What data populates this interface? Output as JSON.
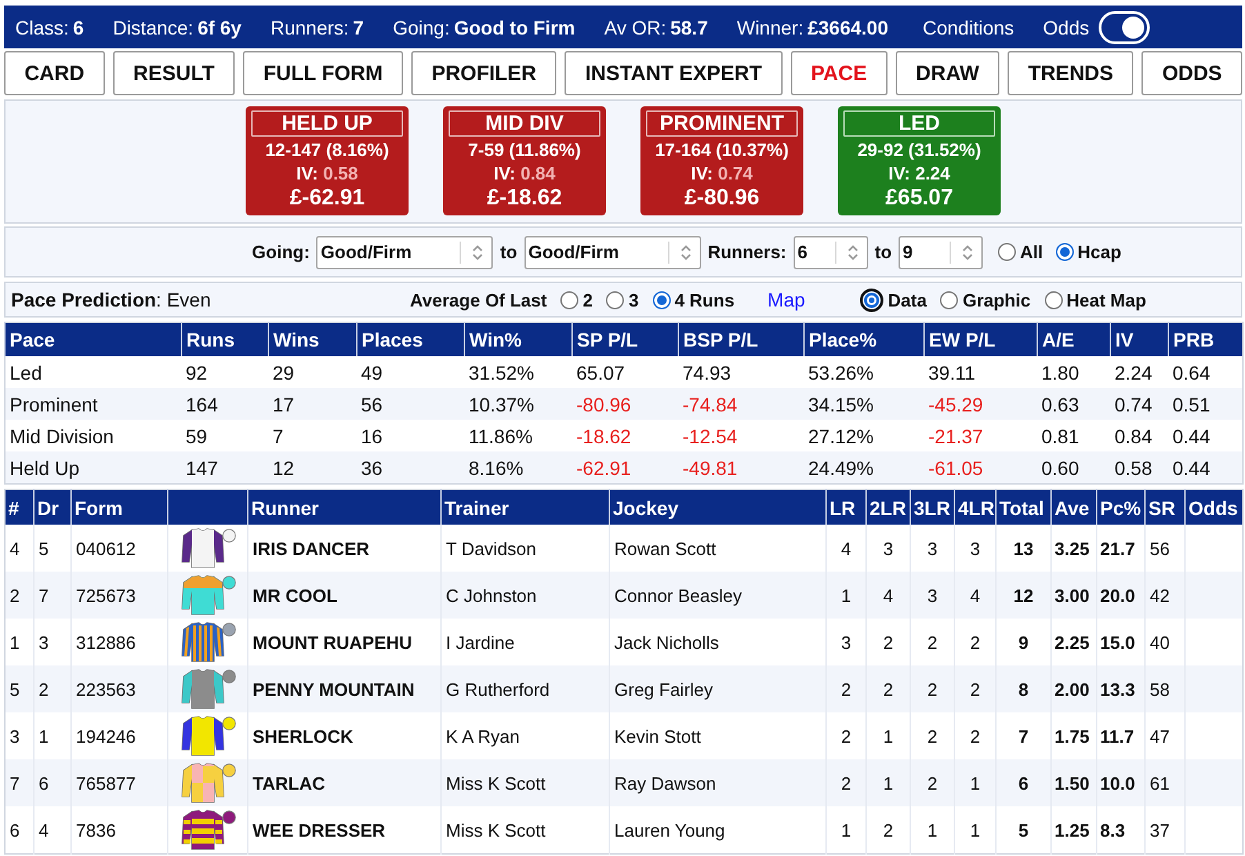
{
  "race_info": {
    "items": [
      {
        "label": "Class:",
        "value": "6"
      },
      {
        "label": "Distance:",
        "value": "6f 6y"
      },
      {
        "label": "Runners:",
        "value": "7"
      },
      {
        "label": "Going:",
        "value": "Good to Firm"
      },
      {
        "label": "Av OR:",
        "value": "58.7"
      },
      {
        "label": "Winner:",
        "value": "£3664.00"
      }
    ],
    "conditions_link": "Conditions",
    "odds_toggle": {
      "label": "Odds",
      "on": true
    }
  },
  "tabs": [
    {
      "label": "CARD",
      "selected": false
    },
    {
      "label": "RESULT",
      "selected": false
    },
    {
      "label": "FULL FORM",
      "selected": false
    },
    {
      "label": "PROFILER",
      "selected": false
    },
    {
      "label": "INSTANT EXPERT",
      "selected": false
    },
    {
      "label": "PACE",
      "selected": true
    },
    {
      "label": "DRAW",
      "selected": false
    },
    {
      "label": "TRENDS",
      "selected": false
    },
    {
      "label": "ODDS",
      "selected": false
    }
  ],
  "pace_summary": [
    {
      "kind": "loss",
      "title": "HELD UP",
      "record": "12-147 (8.16%)",
      "iv_label": "IV:",
      "iv": "0.58",
      "profit": "£-62.91"
    },
    {
      "kind": "loss",
      "title": "MID DIV",
      "record": "7-59 (11.86%)",
      "iv_label": "IV:",
      "iv": "0.84",
      "profit": "£-18.62"
    },
    {
      "kind": "loss",
      "title": "PROMINENT",
      "record": "17-164 (10.37%)",
      "iv_label": "IV:",
      "iv": "0.74",
      "profit": "£-80.96"
    },
    {
      "kind": "profit",
      "title": "LED",
      "record": "29-92 (31.52%)",
      "iv_label": "IV:",
      "iv": "2.24",
      "profit": "£65.07"
    }
  ],
  "filters": {
    "going_label": "Going:",
    "going_from": "Good/Firm",
    "going_to_label": "to",
    "going_to": "Good/Firm",
    "runners_label": "Runners:",
    "runners_from": "6",
    "runners_to_label": "to",
    "runners_to": "9",
    "race_types": [
      {
        "label": "All",
        "selected": false
      },
      {
        "label": "Hcap",
        "selected": true
      }
    ]
  },
  "prediction_bar": {
    "prediction": "**Pace Prediction**: Even",
    "average_label": "Average Of Last",
    "run_counts": [
      {
        "label": "2",
        "selected": false
      },
      {
        "label": "3",
        "selected": false
      },
      {
        "label": "4 Runs",
        "selected": true
      }
    ],
    "map_link": "Map",
    "views": [
      {
        "label": "Data",
        "selected": true,
        "focused": true
      },
      {
        "label": "Graphic",
        "selected": false,
        "focused": false
      },
      {
        "label": "Heat Map",
        "selected": false,
        "focused": false
      }
    ]
  },
  "pace_table": {
    "columns": [
      "Pace",
      "Runs",
      "Wins",
      "Places",
      "Win%",
      "SP P/L",
      "BSP P/L",
      "Place%",
      "EW P/L",
      "A/E",
      "IV",
      "PRB"
    ],
    "rows": [
      {
        "pace": "Led",
        "runs": "92",
        "wins": "29",
        "places": "49",
        "win_pct": "31.52%",
        "sp_pl": {
          "text": "65.07",
          "negative": false
        },
        "bsp_pl": {
          "text": "74.93",
          "negative": false
        },
        "place_pct": "53.26%",
        "ew_pl": {
          "text": "39.11",
          "negative": false
        },
        "ae": "1.80",
        "iv": "2.24",
        "prb": "0.64"
      },
      {
        "pace": "Prominent",
        "runs": "164",
        "wins": "17",
        "places": "56",
        "win_pct": "10.37%",
        "sp_pl": {
          "text": "-80.96",
          "negative": true
        },
        "bsp_pl": {
          "text": "-74.84",
          "negative": true
        },
        "place_pct": "34.15%",
        "ew_pl": {
          "text": "-45.29",
          "negative": true
        },
        "ae": "0.63",
        "iv": "0.74",
        "prb": "0.51"
      },
      {
        "pace": "Mid Division",
        "runs": "59",
        "wins": "7",
        "places": "16",
        "win_pct": "11.86%",
        "sp_pl": {
          "text": "-18.62",
          "negative": true
        },
        "bsp_pl": {
          "text": "-12.54",
          "negative": true
        },
        "place_pct": "27.12%",
        "ew_pl": {
          "text": "-21.37",
          "negative": true
        },
        "ae": "0.81",
        "iv": "0.84",
        "prb": "0.44"
      },
      {
        "pace": "Held Up",
        "runs": "147",
        "wins": "12",
        "places": "36",
        "win_pct": "8.16%",
        "sp_pl": {
          "text": "-62.91",
          "negative": true
        },
        "bsp_pl": {
          "text": "-49.81",
          "negative": true
        },
        "place_pct": "24.49%",
        "ew_pl": {
          "text": "-61.05",
          "negative": true
        },
        "ae": "0.60",
        "iv": "0.58",
        "prb": "0.44"
      }
    ]
  },
  "runners_table": {
    "columns": [
      {
        "kind": "text",
        "label": "#"
      },
      {
        "kind": "text",
        "label": "Dr"
      },
      {
        "kind": "text",
        "label": "Form"
      },
      {
        "kind": "silk"
      },
      {
        "kind": "text",
        "label": "Runner"
      },
      {
        "kind": "text",
        "label": "Trainer"
      },
      {
        "kind": "text",
        "label": "Jockey"
      },
      {
        "kind": "text",
        "label": "LR"
      },
      {
        "kind": "text",
        "label": "2LR"
      },
      {
        "kind": "text",
        "label": "3LR"
      },
      {
        "kind": "text",
        "label": "4LR"
      },
      {
        "kind": "text",
        "label": "Total"
      },
      {
        "kind": "text",
        "label": "Ave"
      },
      {
        "kind": "text",
        "label": "Pc%"
      },
      {
        "kind": "text",
        "label": "SR"
      },
      {
        "kind": "text",
        "label": "Odds"
      }
    ],
    "rows": [
      {
        "number": "4",
        "draw": "5",
        "form": "040612",
        "silk": {
          "kind": "plain",
          "body": {
            "color": "#f4f4f4"
          },
          "trim": {
            "color": "#5a2a8a"
          },
          "cap": {
            "color": "#f4f4f4"
          }
        },
        "runner": "IRIS DANCER",
        "trainer": "T Davidson",
        "jockey": "Rowan Scott",
        "lr": "4",
        "lr2": "3",
        "lr3": "3",
        "lr4": "3",
        "total": "13",
        "ave": "3.25",
        "pc": "21.7",
        "sr": "56"
      },
      {
        "number": "2",
        "draw": "7",
        "form": "725673",
        "silk": {
          "kind": "yoke",
          "body": {
            "color": "#3fdcd4"
          },
          "trim": {
            "color": "#f0a030"
          },
          "cap": {
            "color": "#3fdcd4"
          }
        },
        "runner": "MR COOL",
        "trainer": "C Johnston",
        "jockey": "Connor Beasley",
        "lr": "1",
        "lr2": "4",
        "lr3": "3",
        "lr4": "4",
        "total": "12",
        "ave": "3.00",
        "pc": "20.0",
        "sr": "42"
      },
      {
        "number": "1",
        "draw": "3",
        "form": "312886",
        "silk": {
          "kind": "stripes",
          "body": {
            "color": "#2a62c6"
          },
          "trim": {
            "color": "#f0a020"
          },
          "cap": {
            "color": "#9aa3b0"
          }
        },
        "runner": "MOUNT RUAPEHU",
        "trainer": "I Jardine",
        "jockey": "Jack Nicholls",
        "lr": "3",
        "lr2": "2",
        "lr3": "2",
        "lr4": "2",
        "total": "9",
        "ave": "2.25",
        "pc": "15.0",
        "sr": "40"
      },
      {
        "number": "5",
        "draw": "2",
        "form": "223563",
        "silk": {
          "kind": "plain",
          "body": {
            "color": "#8c8c8c"
          },
          "trim": {
            "color": "#3cc8c8"
          },
          "cap": {
            "color": "#8c8c8c"
          }
        },
        "runner": "PENNY MOUNTAIN",
        "trainer": "G Rutherford",
        "jockey": "Greg Fairley",
        "lr": "2",
        "lr2": "2",
        "lr3": "2",
        "lr4": "2",
        "total": "8",
        "ave": "2.00",
        "pc": "13.3",
        "sr": "58"
      },
      {
        "number": "3",
        "draw": "1",
        "form": "194246",
        "silk": {
          "kind": "plain",
          "body": {
            "color": "#f2e600"
          },
          "trim": {
            "color": "#3434e0"
          },
          "cap": {
            "color": "#f2e600"
          }
        },
        "runner": "SHERLOCK",
        "trainer": "K A Ryan",
        "jockey": "Kevin Stott",
        "lr": "2",
        "lr2": "1",
        "lr3": "2",
        "lr4": "2",
        "total": "7",
        "ave": "1.75",
        "pc": "11.7",
        "sr": "47"
      },
      {
        "number": "7",
        "draw": "6",
        "form": "765877",
        "silk": {
          "kind": "quartered",
          "body": {
            "color": "#f8b4b4"
          },
          "trim": {
            "color": "#f6d040"
          },
          "cap": {
            "color": "#f6d040"
          }
        },
        "runner": "TARLAC",
        "trainer": "Miss K Scott",
        "jockey": "Ray Dawson",
        "lr": "2",
        "lr2": "1",
        "lr3": "2",
        "lr4": "1",
        "total": "6",
        "ave": "1.50",
        "pc": "10.0",
        "sr": "61"
      },
      {
        "number": "6",
        "draw": "4",
        "form": "7836",
        "silk": {
          "kind": "hoops",
          "body": {
            "color": "#8e1a7c"
          },
          "trim": {
            "color": "#f2d000"
          },
          "cap": {
            "color": "#8e1a7c"
          }
        },
        "runner": "WEE DRESSER",
        "trainer": "Miss K Scott",
        "jockey": "Lauren Young",
        "lr": "1",
        "lr2": "2",
        "lr3": "1",
        "lr4": "1",
        "total": "5",
        "ave": "1.25",
        "pc": "8.3",
        "sr": "37"
      }
    ]
  }
}
